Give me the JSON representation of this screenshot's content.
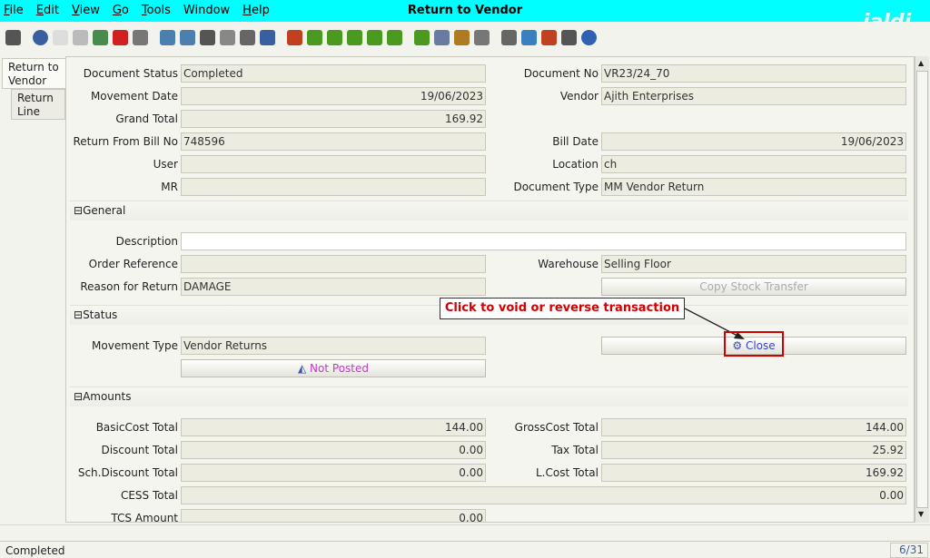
{
  "window": {
    "title": "Return to Vendor",
    "logo": "jaldi"
  },
  "menu": [
    "File",
    "Edit",
    "View",
    "Go",
    "Tools",
    "Window",
    "Help"
  ],
  "menu_underline": [
    "F",
    "E",
    "V",
    "G",
    "T",
    "",
    "H"
  ],
  "toolbar_icons": [
    "undo-icon",
    "help-icon",
    "new-icon",
    "copy-icon",
    "save-icon",
    "delete-icon",
    "save-disk-icon",
    "refresh-icon",
    "find-icon",
    "attach-icon",
    "chat-icon",
    "history-icon",
    "home-icon",
    "back-icon",
    "forward-icon",
    "first-icon",
    "prev-icon",
    "next-icon",
    "last-icon",
    "report-icon",
    "archive-icon",
    "print-preview-icon",
    "print-icon",
    "zoom-icon",
    "workflow-icon",
    "product-icon",
    "request-icon",
    "close-window-icon"
  ],
  "tabs": {
    "return_to_vendor": "Return to Vendor",
    "return_line": "Return Line"
  },
  "form": {
    "document_status": {
      "label": "Document Status",
      "value": "Completed"
    },
    "document_no": {
      "label": "Document No",
      "value": "VR23/24_70"
    },
    "movement_date": {
      "label": "Movement Date",
      "value": "19/06/2023"
    },
    "vendor": {
      "label": "Vendor",
      "value": "Ajith Enterprises"
    },
    "grand_total": {
      "label": "Grand Total",
      "value": "169.92"
    },
    "return_from_bill_no": {
      "label": "Return From Bill No",
      "value": "748596"
    },
    "bill_date": {
      "label": "Bill Date",
      "value": "19/06/2023"
    },
    "user": {
      "label": "User",
      "value": ""
    },
    "location": {
      "label": "Location",
      "value": "ch"
    },
    "mr": {
      "label": "MR",
      "value": ""
    },
    "document_type": {
      "label": "Document Type",
      "value": "MM Vendor Return"
    }
  },
  "general": {
    "section": "General",
    "description": {
      "label": "Description",
      "value": ""
    },
    "order_reference": {
      "label": "Order Reference",
      "value": ""
    },
    "warehouse": {
      "label": "Warehouse",
      "value": "Selling Floor"
    },
    "reason_for_return": {
      "label": "Reason for Return",
      "value": "DAMAGE"
    },
    "copy_stock_transfer": "Copy Stock Transfer"
  },
  "status": {
    "section": "Status",
    "movement_type": {
      "label": "Movement Type",
      "value": "Vendor Returns"
    },
    "close_button": "Close",
    "not_posted_button": "Not Posted"
  },
  "amounts": {
    "section": "Amounts",
    "basic_cost_total": {
      "label": "BasicCost Total",
      "value": "144.00"
    },
    "gross_cost_total": {
      "label": "GrossCost Total",
      "value": "144.00"
    },
    "discount_total": {
      "label": "Discount Total",
      "value": "0.00"
    },
    "tax_total": {
      "label": "Tax Total",
      "value": "25.92"
    },
    "sch_discount_total": {
      "label": "Sch.Discount Total",
      "value": "0.00"
    },
    "l_cost_total": {
      "label": "L.Cost Total",
      "value": "169.92"
    },
    "cess_total": {
      "label": "CESS Total",
      "value": "0.00"
    },
    "tcs_amount": {
      "label": "TCS Amount",
      "value": "0.00"
    }
  },
  "annotation": {
    "callout": "Click to void or reverse transaction"
  },
  "statusbar": {
    "text": "Completed",
    "page": "6/31"
  },
  "colors": {
    "titlebar": "#00ffff",
    "callout_text": "#d40000",
    "link_blue": "#3344cc",
    "not_posted": "#cc33cc"
  }
}
